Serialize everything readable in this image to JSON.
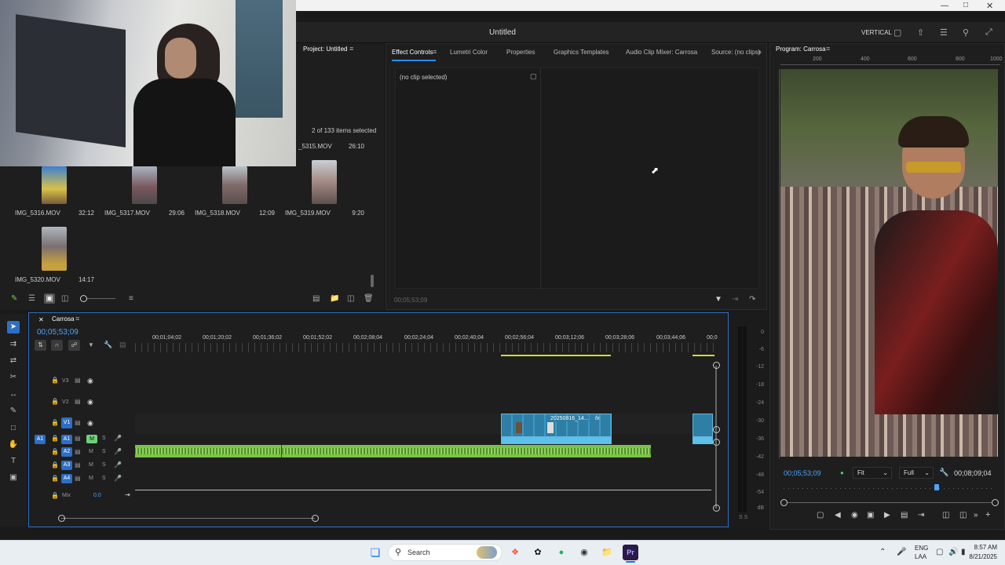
{
  "window": {
    "title": "Untitled",
    "workspace_label": "VERTICAL"
  },
  "project": {
    "tab": "Project: Untitled",
    "selection_status": "2 of 133 items selected",
    "partial_item": {
      "name": "_5315.MOV",
      "duration": "26:10"
    },
    "items": [
      {
        "name": "IMG_5316.MOV",
        "duration": "32:12"
      },
      {
        "name": "IMG_5317.MOV",
        "duration": "29:06"
      },
      {
        "name": "IMG_5318.MOV",
        "duration": "12:09"
      },
      {
        "name": "IMG_5319.MOV",
        "duration": "9:20"
      },
      {
        "name": "IMG_5320.MOV",
        "duration": "14:17"
      }
    ]
  },
  "effects": {
    "tabs": [
      "Effect Controls",
      "Lumetri Color",
      "Properties",
      "Graphics Templates",
      "Audio Clip Mixer: Carrosa",
      "Source: (no clips)"
    ],
    "no_clip": "(no clip selected)",
    "timecode": "00;05;53;09"
  },
  "program": {
    "tab": "Program: Carrosa",
    "ruler": [
      "200",
      "400",
      "600",
      "800",
      "1000"
    ],
    "timecode": "00;05;53;09",
    "fit": "Fit",
    "quality": "Full",
    "duration": "00;08;09;04"
  },
  "timeline": {
    "tab": "Carrosa",
    "timecode": "00;05;53;09",
    "ruler": [
      "00;01;04;02",
      "00;01;20;02",
      "00;01;36;02",
      "00;01;52;02",
      "00;02;08;04",
      "00;02;24;04",
      "00;02;40;04",
      "00;02;56;04",
      "00;03;12;06",
      "00;03;28;06",
      "00;03;44;06",
      "00;0"
    ],
    "video_tracks": [
      "V3",
      "V2",
      "V1"
    ],
    "audio_tracks": [
      "A1",
      "A2",
      "A3",
      "A4"
    ],
    "mix_label": "Mix",
    "mix_value": "0.0",
    "source_patch_v": "V1",
    "source_patch_a": "A1",
    "clip_name": "20250816_14...",
    "clip_fx": "fx",
    "m_label": "M",
    "s_label": "S"
  },
  "meters": {
    "labels": [
      "0",
      "-6",
      "-12",
      "-18",
      "-24",
      "-30",
      "-36",
      "-42",
      "-48",
      "-54",
      "dB"
    ],
    "footer": "S S"
  },
  "taskbar": {
    "search": "Search",
    "lang1": "ENG",
    "lang2": "LAA",
    "time": "8:57 AM",
    "date": "8/21/2025"
  },
  "colors": {
    "accent": "#2d8ceb",
    "clip_video": "#3a9ac4",
    "clip_audio": "#7cc24a",
    "timecode": "#4da3ff"
  }
}
